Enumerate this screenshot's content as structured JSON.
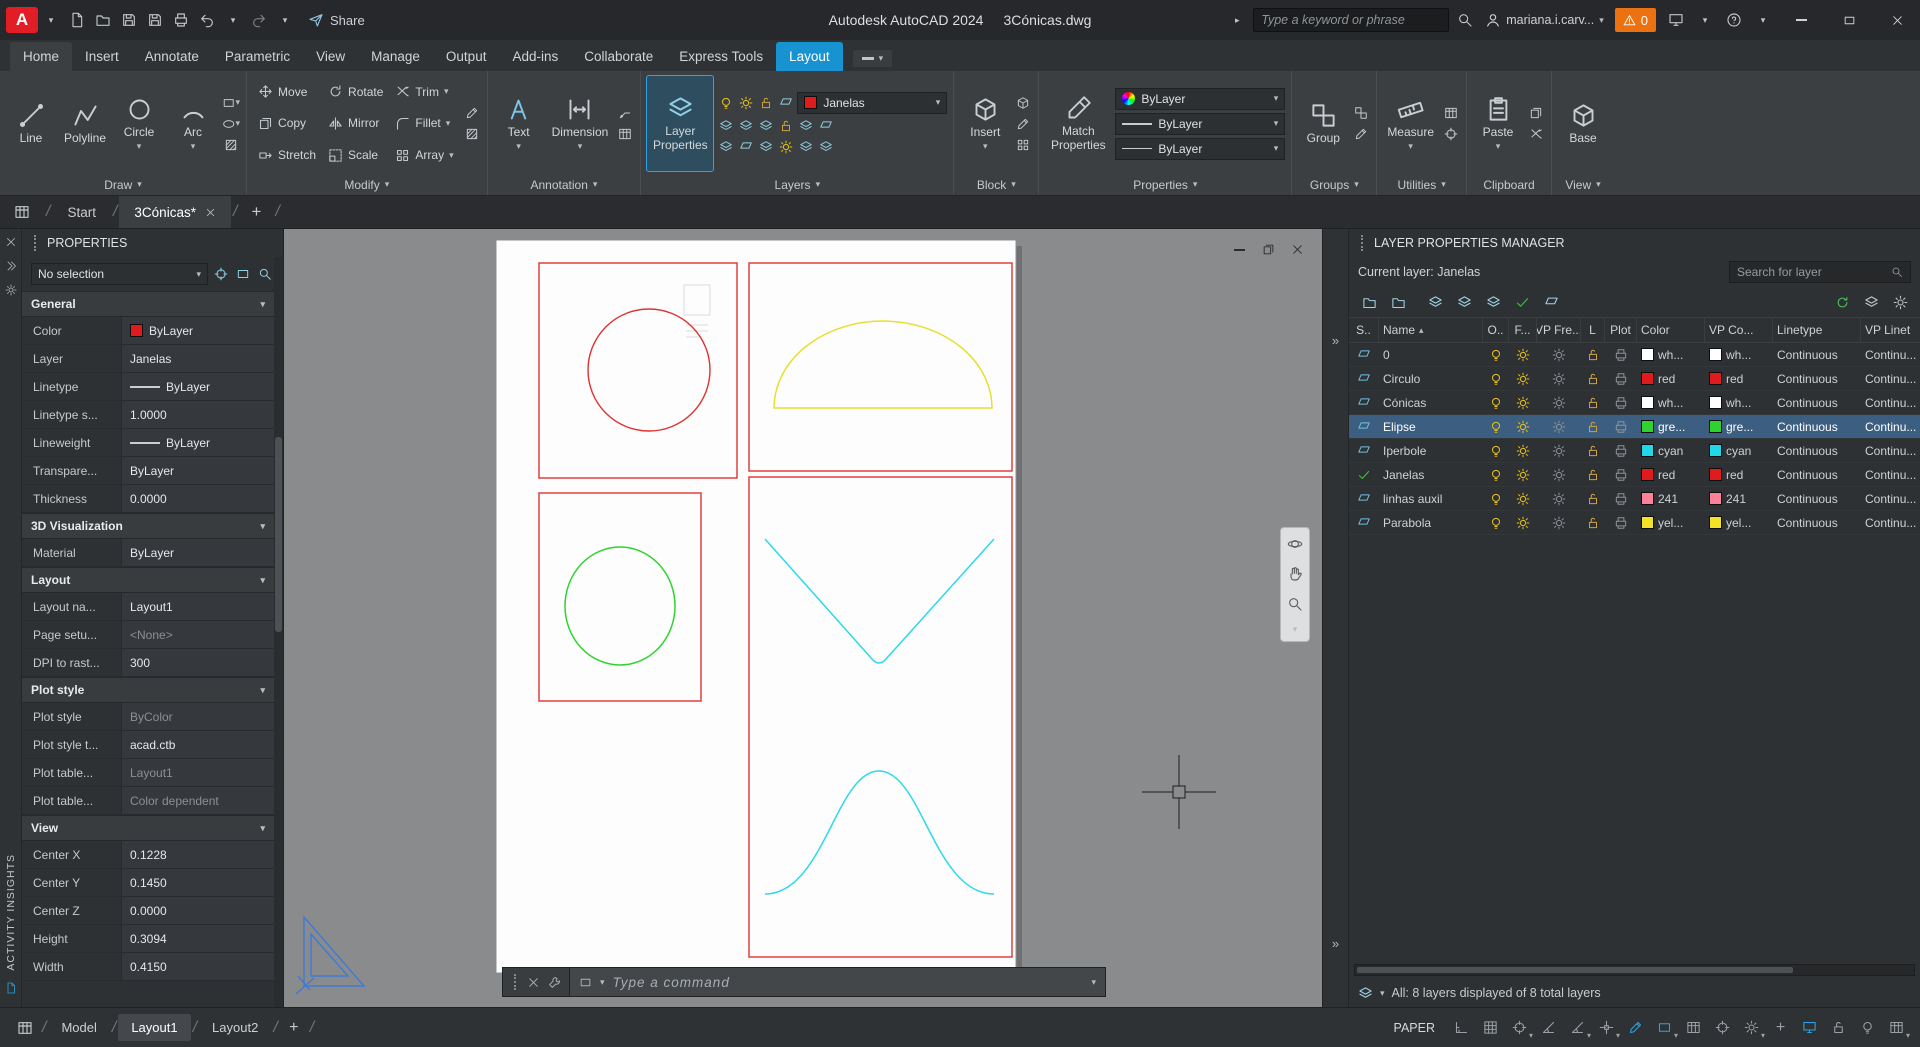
{
  "icons": {
    "caret_down": "▾",
    "caret_right": "▸",
    "slash": "/",
    "sort_asc": "▴",
    "plus": "+",
    "chevrons_right": "»"
  },
  "colors": {
    "accent": "#1793d1",
    "alert_orange": "#ec7211",
    "logo_red": "#e11d26",
    "viewport_red": "#e03131",
    "shape_yellow": "#e6e02e",
    "shape_green": "#2fd32f",
    "shape_cyan": "#2bd9ea",
    "selected_row": "#3c5e80"
  },
  "titlebar": {
    "logo_letter": "A",
    "app_title": "Autodesk AutoCAD 2024",
    "doc_title": "3Cónicas.dwg",
    "share_label": "Share",
    "search_placeholder": "Type a keyword or phrase",
    "user_name": "mariana.i.carv...",
    "alert_count": "0"
  },
  "ribbon": {
    "tabs": [
      {
        "label": "Home",
        "state": "active"
      },
      {
        "label": "Insert",
        "state": "normal"
      },
      {
        "label": "Annotate",
        "state": "normal"
      },
      {
        "label": "Parametric",
        "state": "normal"
      },
      {
        "label": "View",
        "state": "normal"
      },
      {
        "label": "Manage",
        "state": "normal"
      },
      {
        "label": "Output",
        "state": "normal"
      },
      {
        "label": "Add-ins",
        "state": "normal"
      },
      {
        "label": "Collaborate",
        "state": "normal"
      },
      {
        "label": "Express Tools",
        "state": "normal"
      },
      {
        "label": "Layout",
        "state": "context"
      }
    ],
    "panels": {
      "draw": {
        "label": "Draw",
        "buttons": [
          {
            "label": "Line"
          },
          {
            "label": "Polyline"
          },
          {
            "label": "Circle"
          },
          {
            "label": "Arc"
          }
        ]
      },
      "modify": {
        "label": "Modify",
        "items": [
          "Move",
          "Rotate",
          "Trim",
          "Copy",
          "Mirror",
          "Fillet",
          "Stretch",
          "Scale",
          "Array"
        ]
      },
      "annotation": {
        "label": "Annotation",
        "buttons": [
          {
            "label": "Text"
          },
          {
            "label": "Dimension"
          }
        ]
      },
      "layers": {
        "label": "Layers",
        "main_button": "Layer Properties",
        "layer_dropdown": "Janelas"
      },
      "block": {
        "label": "Block",
        "main_button": "Insert"
      },
      "properties": {
        "label": "Properties",
        "main_button": "Match Properties",
        "dropdowns": [
          "ByLayer",
          "ByLayer",
          "ByLayer"
        ]
      },
      "groups": {
        "label": "Groups",
        "main_button": "Group"
      },
      "utilities": {
        "label": "Utilities",
        "main_button": "Measure"
      },
      "clipboard": {
        "label": "Clipboard",
        "main_button": "Paste"
      },
      "view": {
        "label": "View",
        "main_button": "Base"
      }
    }
  },
  "file_tabs": {
    "start": "Start",
    "doc": "3Cónicas*"
  },
  "properties_palette": {
    "title": "PROPERTIES",
    "selector": "No selection",
    "activity_label": "ACTIVITY INSIGHTS",
    "sections": [
      {
        "title": "General",
        "rows": [
          {
            "label": "Color",
            "value": "ByLayer",
            "swatch": "#e01b1b"
          },
          {
            "label": "Layer",
            "value": "Janelas"
          },
          {
            "label": "Linetype",
            "value": "ByLayer",
            "line": true
          },
          {
            "label": "Linetype s...",
            "value": "1.0000"
          },
          {
            "label": "Lineweight",
            "value": "ByLayer",
            "line": true
          },
          {
            "label": "Transpare...",
            "value": "ByLayer"
          },
          {
            "label": "Thickness",
            "value": "0.0000"
          }
        ]
      },
      {
        "title": "3D Visualization",
        "rows": [
          {
            "label": "Material",
            "value": "ByLayer"
          }
        ]
      },
      {
        "title": "Lay​out",
        "rows": [
          {
            "label": "Layout na...",
            "value": "Layout1"
          },
          {
            "label": "Page setu...",
            "value": "<None>",
            "muted": true
          },
          {
            "label": "DPI to rast...",
            "value": "300"
          }
        ]
      },
      {
        "title": "Plot style",
        "rows": [
          {
            "label": "Plot style",
            "value": "ByColor",
            "muted": true
          },
          {
            "label": "Plot style t...",
            "value": "acad.ctb"
          },
          {
            "label": "Plot table...",
            "value": "Layout1",
            "muted": true
          },
          {
            "label": "Plot table...",
            "value": "Color dependent",
            "muted": true
          }
        ]
      },
      {
        "title": "View",
        "rows": [
          {
            "label": "Center X",
            "value": "0.1228"
          },
          {
            "label": "Center Y",
            "value": "0.1450"
          },
          {
            "label": "Center Z",
            "value": "0.0000"
          },
          {
            "label": "Height",
            "value": "0.3094"
          },
          {
            "label": "Width",
            "value": "0.4150"
          }
        ]
      }
    ]
  },
  "command_line": {
    "placeholder": "Type a command"
  },
  "layer_manager": {
    "title": "LAYER PROPERTIES MANAGER",
    "current_layer": "Current layer: Janelas",
    "search_placeholder": "Search for layer",
    "columns": [
      "S..",
      "Name",
      "O..",
      "F...",
      "VP Fre...",
      "L",
      "Plot",
      "Color",
      "VP Co...",
      "Linetype",
      "VP Linet"
    ],
    "layers": [
      {
        "name": "0",
        "color_label": "wh...",
        "color": "#ffffff",
        "vp_color_label": "wh...",
        "vp_color": "#ffffff",
        "linetype": "Continuous",
        "vp_linetype": "Continu...",
        "current": false,
        "selected": false
      },
      {
        "name": "Circulo",
        "color_label": "red",
        "color": "#e01b1b",
        "vp_color_label": "red",
        "vp_color": "#e01b1b",
        "linetype": "Continuous",
        "vp_linetype": "Continu...",
        "current": false,
        "selected": false
      },
      {
        "name": "Cónicas",
        "color_label": "wh...",
        "color": "#ffffff",
        "vp_color_label": "wh...",
        "vp_color": "#ffffff",
        "linetype": "Continuous",
        "vp_linetype": "Continu...",
        "current": false,
        "selected": false
      },
      {
        "name": "Elipse",
        "color_label": "gre...",
        "color": "#2fd32f",
        "vp_color_label": "gre...",
        "vp_color": "#2fd32f",
        "linetype": "Continuous",
        "vp_linetype": "Continu...",
        "current": false,
        "selected": true
      },
      {
        "name": "Iperbole",
        "color_label": "cyan",
        "color": "#21d8e8",
        "vp_color_label": "cyan",
        "vp_color": "#21d8e8",
        "linetype": "Continuous",
        "vp_linetype": "Continu...",
        "current": false,
        "selected": false
      },
      {
        "name": "Janelas",
        "color_label": "red",
        "color": "#e01b1b",
        "vp_color_label": "red",
        "vp_color": "#e01b1b",
        "linetype": "Continuous",
        "vp_linetype": "Continu...",
        "current": true,
        "selected": false
      },
      {
        "name": "linhas auxil",
        "color_label": "241",
        "color": "#ff8099",
        "vp_color_label": "241",
        "vp_color": "#ff8099",
        "linetype": "Continuous",
        "vp_linetype": "Continu...",
        "current": false,
        "selected": false
      },
      {
        "name": "Parabola",
        "color_label": "yel...",
        "color": "#f2e228",
        "vp_color_label": "yel...",
        "vp_color": "#f2e228",
        "linetype": "Continuous",
        "vp_linetype": "Continu...",
        "current": false,
        "selected": false
      }
    ],
    "footer": "All: 8 layers displayed of 8 total layers"
  },
  "status_bar": {
    "model": "Model",
    "layouts": [
      "Layout1",
      "Layout2"
    ],
    "active_layout": "Layout1",
    "paper": "PAPER",
    "icons": [
      {
        "name": "ruler",
        "active": false
      },
      {
        "name": "grid",
        "active": false
      },
      {
        "name": "snap",
        "active": false,
        "caret": true
      },
      {
        "name": "ortho",
        "active": false
      },
      {
        "name": "polar",
        "active": false,
        "caret": true
      },
      {
        "name": "osnap",
        "active": false,
        "caret": true
      },
      {
        "name": "lineweight",
        "active": true
      },
      {
        "name": "selection-cycling",
        "active": true,
        "caret": true
      },
      {
        "name": "units",
        "active": false
      },
      {
        "name": "target",
        "active": false
      },
      {
        "name": "gear",
        "active": false,
        "caret": true
      },
      {
        "name": "plus",
        "active": false
      },
      {
        "name": "graphics",
        "active": true
      },
      {
        "name": "lock",
        "active": false
      },
      {
        "name": "isolate",
        "active": false
      },
      {
        "name": "customization",
        "active": false,
        "caret": true
      }
    ]
  }
}
